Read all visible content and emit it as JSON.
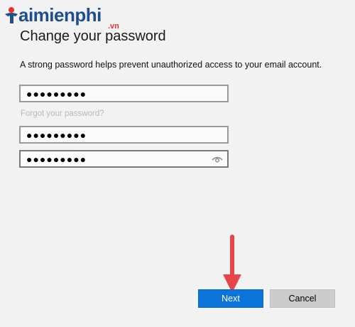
{
  "watermark": {
    "brand": "aimienphi",
    "suffix": ".vn"
  },
  "title": "Change your password",
  "description": "A strong password helps prevent unauthorized access to your email account.",
  "fields": {
    "current_password": "●●●●●●●●●",
    "new_password": "●●●●●●●●●",
    "confirm_password": "●●●●●●●●●"
  },
  "forgot_link": "Forgot your password?",
  "buttons": {
    "next": "Next",
    "cancel": "Cancel"
  },
  "icons": {
    "reveal": "eye-icon",
    "annotation": "arrow-down-icon"
  },
  "colors": {
    "accent": "#0a74da",
    "annotation": "#e8454a"
  }
}
